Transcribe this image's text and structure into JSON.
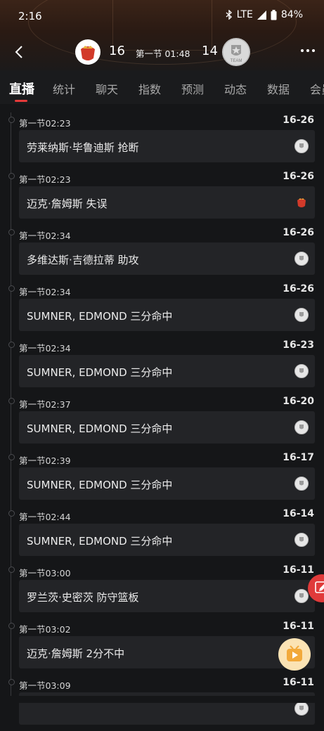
{
  "status_bar": {
    "time": "2:16",
    "network": "LTE",
    "battery": "84%",
    "icons": [
      "bluetooth-icon",
      "signal-icon",
      "battery-icon"
    ]
  },
  "game": {
    "home_score": "16",
    "away_score": "14",
    "period_clock": "第一节 01:48",
    "away_logo_text": "TEAM"
  },
  "tabs": [
    "直播",
    "统计",
    "聊天",
    "指数",
    "预测",
    "动态",
    "数据",
    "会员"
  ],
  "active_tab": 0,
  "events": [
    {
      "time": "第一节02:23",
      "score": "16-26",
      "text": "劳莱纳斯·毕鲁迪斯 抢断",
      "team": "away"
    },
    {
      "time": "第一节02:23",
      "score": "16-26",
      "text": "迈克·詹姆斯 失误",
      "team": "home"
    },
    {
      "time": "第一节02:34",
      "score": "16-26",
      "text": "多维达斯·吉德拉蒂 助攻",
      "team": "away"
    },
    {
      "time": "第一节02:34",
      "score": "16-26",
      "text": "SUMNER, EDMOND 三分命中",
      "team": "away"
    },
    {
      "time": "第一节02:34",
      "score": "16-23",
      "text": "SUMNER, EDMOND 三分命中",
      "team": "away"
    },
    {
      "time": "第一节02:37",
      "score": "16-20",
      "text": "SUMNER, EDMOND 三分命中",
      "team": "away"
    },
    {
      "time": "第一节02:39",
      "score": "16-17",
      "text": "SUMNER, EDMOND 三分命中",
      "team": "away"
    },
    {
      "time": "第一节02:44",
      "score": "16-14",
      "text": "SUMNER, EDMOND 三分命中",
      "team": "away"
    },
    {
      "time": "第一节03:00",
      "score": "16-11",
      "text": "罗兰茨·史密茨 防守篮板",
      "team": "away"
    },
    {
      "time": "第一节03:02",
      "score": "16-11",
      "text": "迈克·詹姆斯 2分不中",
      "team": "home"
    },
    {
      "time": "第一节03:09",
      "score": "16-11",
      "text": "",
      "team": "away"
    }
  ],
  "colors": {
    "accent": "#e43a3a",
    "background": "#151618",
    "card": "#232427",
    "float_video": "#fbe3b4"
  }
}
